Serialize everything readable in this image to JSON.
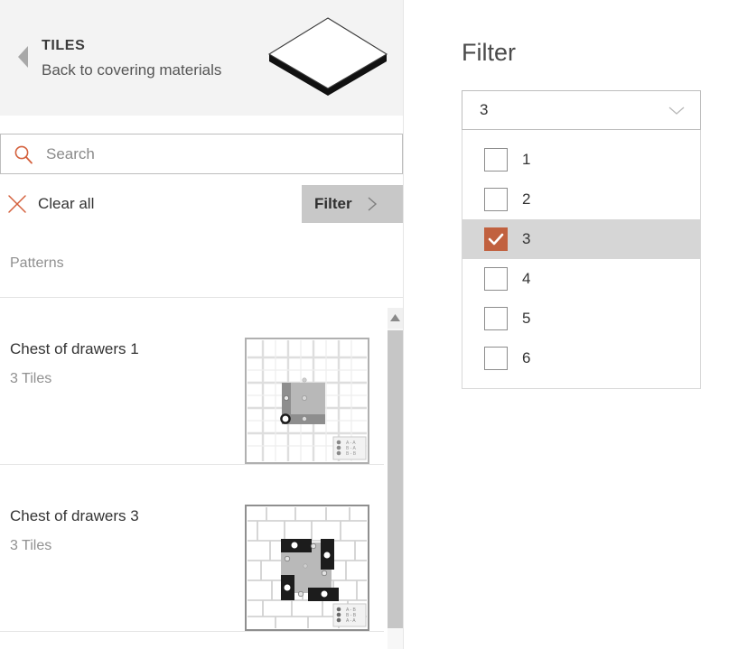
{
  "left_panel": {
    "header": {
      "back_icon": "back-triangle-icon",
      "title": "TILES",
      "subtitle": "Back to covering materials",
      "tile_icon": "isometric-tile-icon"
    },
    "search": {
      "icon": "search-icon",
      "placeholder": "Search",
      "value": ""
    },
    "clear_all": {
      "icon": "close-x-icon",
      "label": "Clear all"
    },
    "filter_button": {
      "label": "Filter",
      "chevron_icon": "chevron-right-icon"
    },
    "group_label": "Patterns",
    "results": [
      {
        "title": "Chest of drawers 1",
        "subtitle": "3 Tiles",
        "thumbnail": "floor-plan-thumbnail"
      },
      {
        "title": "Chest of drawers 3",
        "subtitle": "3 Tiles",
        "thumbnail": "floor-plan-thumbnail"
      }
    ],
    "scrollbar": {
      "up_arrow_icon": "scroll-up-arrow-icon"
    }
  },
  "right_panel": {
    "heading": "Filter",
    "combobox": {
      "value": "3",
      "chevron_icon": "chevron-down-icon"
    },
    "options": [
      {
        "label": "1",
        "checked": false
      },
      {
        "label": "2",
        "checked": false
      },
      {
        "label": "3",
        "checked": true
      },
      {
        "label": "4",
        "checked": false
      },
      {
        "label": "5",
        "checked": false
      },
      {
        "label": "6",
        "checked": false
      }
    ]
  },
  "colors": {
    "accent": "#c1613f",
    "header_background": "#f3f3f3",
    "filter_button_background": "#c8c8c8",
    "selected_row_background": "#d6d6d6",
    "scrollbar_thumb": "#c6c6c6"
  }
}
